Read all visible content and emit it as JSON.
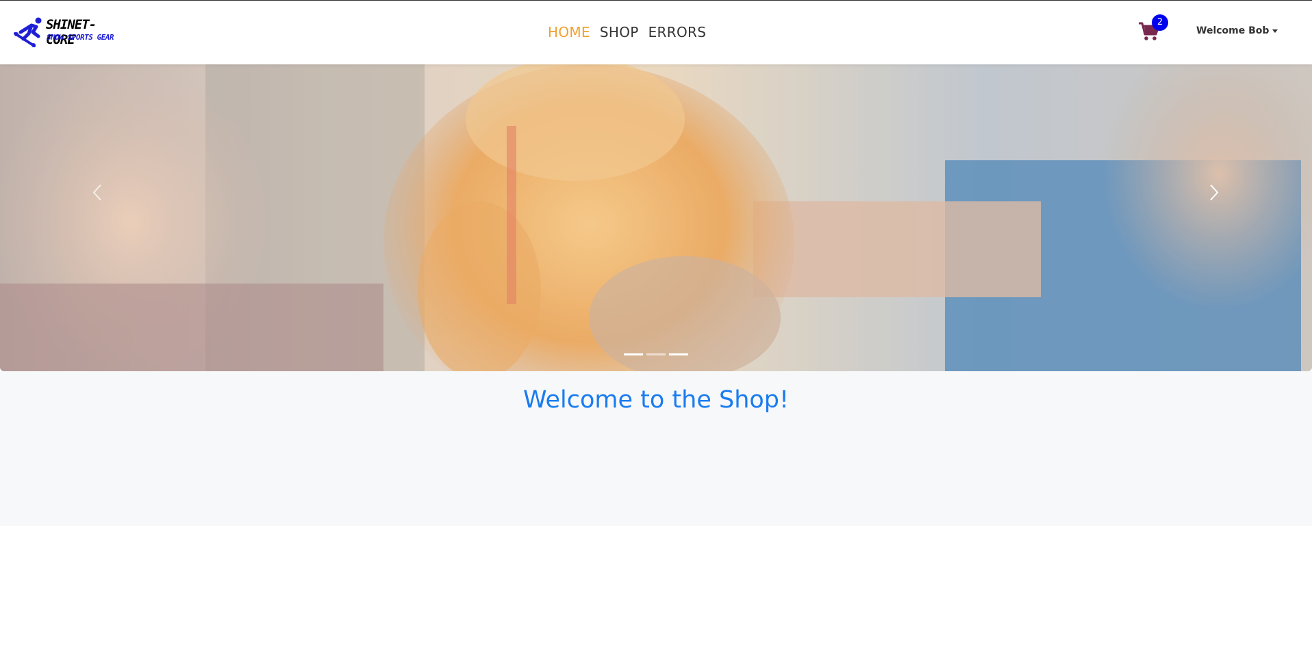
{
  "brand": {
    "line1": "SHINET-CORE",
    "line2": "SNOW SPORTS GEAR"
  },
  "nav": {
    "items": [
      {
        "label": "HOME",
        "active": true
      },
      {
        "label": "SHOP",
        "active": false
      },
      {
        "label": "ERRORS",
        "active": false
      }
    ],
    "active_color": "#f0a030"
  },
  "cart": {
    "icon": "shopping-cart-icon",
    "count": "2",
    "icon_color": "#7a2850",
    "badge_color": "#0000ee"
  },
  "user_menu": {
    "label": "Welcome Bob"
  },
  "carousel": {
    "slide_count": 3,
    "active_index": 0,
    "prev_icon": "chevron-left-icon",
    "next_icon": "chevron-right-icon"
  },
  "welcome": {
    "title": "Welcome to the Shop!",
    "title_color": "#1a7cf0"
  }
}
